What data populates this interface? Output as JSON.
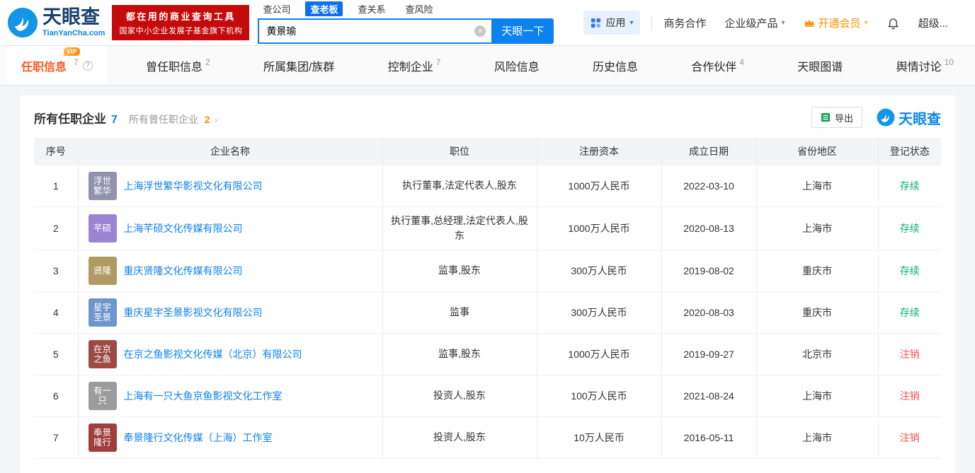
{
  "colors": {
    "brand_blue": "#0b82f0",
    "active_tab_orange": "#ff5722",
    "vip_orange": "#ff9000",
    "slogan_red": "#c40a0a",
    "status_active_green": "#00b368",
    "status_cancelled_red": "#ff4d4f"
  },
  "header": {
    "logo_title": "天眼查",
    "logo_domain": "TianYanCha.com",
    "slogan_line1": "都在用的商业查询工具",
    "slogan_line2": "国家中小企业发展子基金旗下机构",
    "search_tabs": [
      {
        "label": "查公司",
        "active": false
      },
      {
        "label": "查老板",
        "active": true
      },
      {
        "label": "查关系",
        "active": false
      },
      {
        "label": "查风险",
        "active": false
      }
    ],
    "search_value": "黄景瑜",
    "search_button_label": "天眼一下",
    "apps_label": "应用",
    "nav": {
      "biz_coop": "商务合作",
      "enterprise_product": "企业级产品",
      "open_vip": "开通会员",
      "super_vip": "超级..."
    }
  },
  "section_tabs": [
    {
      "label": "任职信息",
      "count": "7",
      "active": true,
      "vip": true,
      "help": true
    },
    {
      "label": "曾任职信息",
      "count": "2"
    },
    {
      "label": "所属集团/族群",
      "count": ""
    },
    {
      "label": "控制企业",
      "count": "7"
    },
    {
      "label": "风险信息",
      "count": ""
    },
    {
      "label": "历史信息",
      "count": ""
    },
    {
      "label": "合作伙伴",
      "count": "4"
    },
    {
      "label": "天眼图谱",
      "count": ""
    },
    {
      "label": "舆情讨论",
      "count": "10"
    }
  ],
  "content": {
    "title": "所有任职企业",
    "title_count": "7",
    "sub_title": "所有曾任职企业",
    "sub_count": "2",
    "sub_arrow": "›",
    "export_label": "导出",
    "brand_watermark": "天眼查"
  },
  "table": {
    "columns": [
      "序号",
      "企业名称",
      "职位",
      "注册资本",
      "成立日期",
      "省份地区",
      "登记状态"
    ],
    "rows": [
      {
        "no": "1",
        "icon_text": "浮世繁华",
        "icon_color": "#9193ac",
        "company": "上海浮世繁华影视文化有限公司",
        "position": "执行董事,法定代表人,股东",
        "capital": "1000万人民币",
        "date": "2022-03-10",
        "region": "上海市",
        "status": "存续",
        "status_color": "#00b368"
      },
      {
        "no": "2",
        "icon_text": "芊硕",
        "icon_color": "#9b84d2",
        "company": "上海芊硕文化传媒有限公司",
        "position": "执行董事,总经理,法定代表人,股东",
        "capital": "1000万人民币",
        "date": "2020-08-13",
        "region": "上海市",
        "status": "存续",
        "status_color": "#00b368"
      },
      {
        "no": "3",
        "icon_text": "贤隆",
        "icon_color": "#b29a63",
        "company": "重庆贤隆文化传媒有限公司",
        "position": "监事,股东",
        "capital": "300万人民币",
        "date": "2019-08-02",
        "region": "重庆市",
        "status": "存续",
        "status_color": "#00b368"
      },
      {
        "no": "4",
        "icon_text": "星宇圣景",
        "icon_color": "#6e95cd",
        "company": "重庆星宇圣景影视文化有限公司",
        "position": "监事",
        "capital": "300万人民币",
        "date": "2020-08-03",
        "region": "重庆市",
        "status": "存续",
        "status_color": "#00b368"
      },
      {
        "no": "5",
        "icon_text": "在京之鱼",
        "icon_color": "#9d4a44",
        "company": "在京之鱼影视文化传媒（北京）有限公司",
        "position": "监事,股东",
        "capital": "1000万人民币",
        "date": "2019-09-27",
        "region": "北京市",
        "status": "注销",
        "status_color": "#ff4d4f"
      },
      {
        "no": "6",
        "icon_text": "有一只",
        "icon_color": "#9c9c9c",
        "company": "上海有一只大鱼京鱼影视文化工作室",
        "position": "投资人,股东",
        "capital": "100万人民币",
        "date": "2021-08-24",
        "region": "上海市",
        "status": "注销",
        "status_color": "#ff4d4f"
      },
      {
        "no": "7",
        "icon_text": "奉景隆行",
        "icon_color": "#a03d3d",
        "company": "奉景隆行文化传媒（上海）工作室",
        "position": "投资人,股东",
        "capital": "10万人民币",
        "date": "2016-05-11",
        "region": "上海市",
        "status": "注销",
        "status_color": "#ff4d4f"
      }
    ]
  }
}
